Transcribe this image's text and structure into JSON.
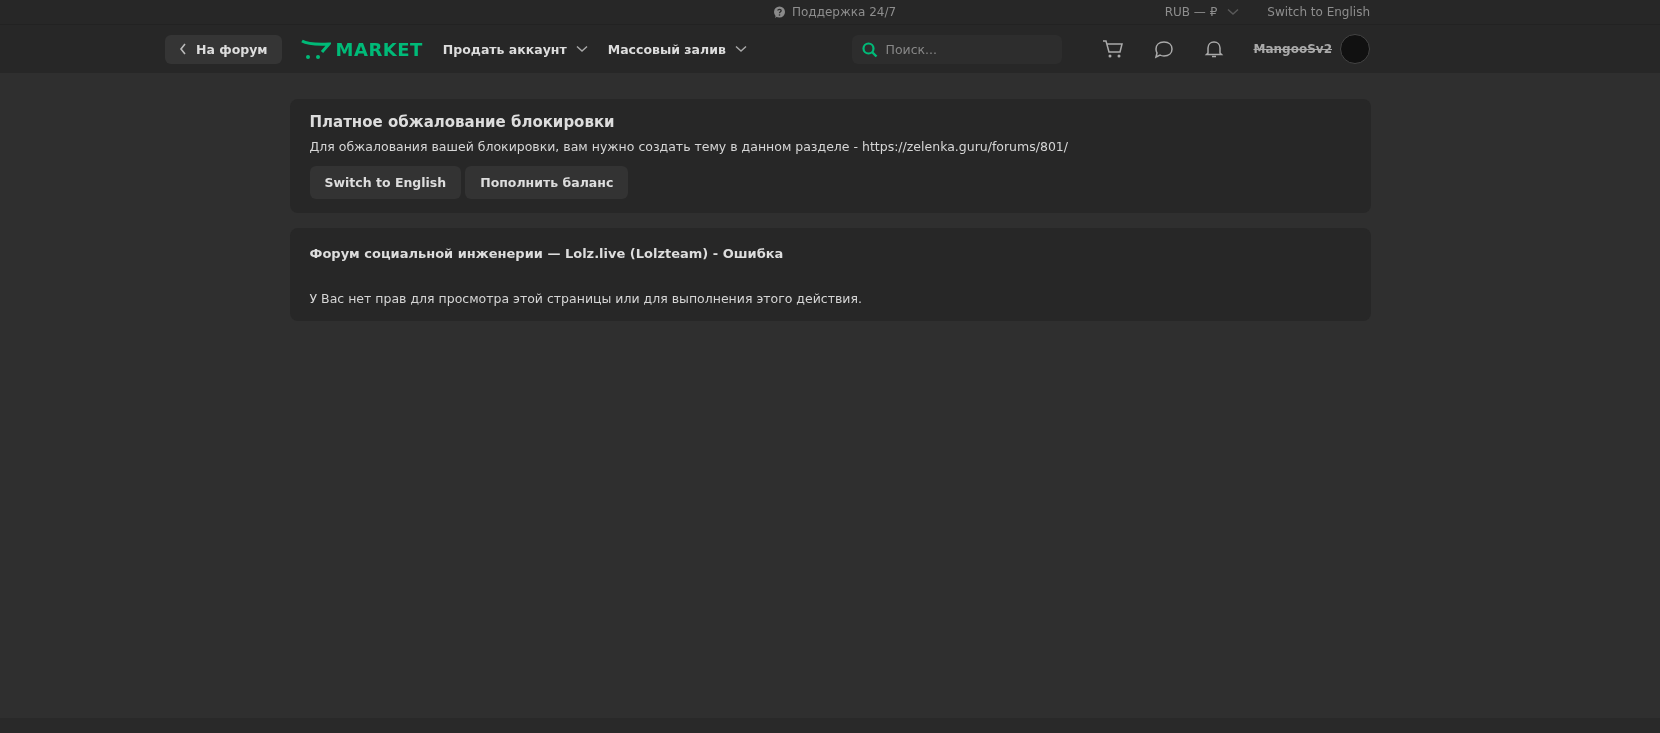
{
  "top_bar": {
    "support": "Поддержка 24/7",
    "currency": "RUB — ₽",
    "language_link": "Switch to English"
  },
  "nav": {
    "back_button": "На форум",
    "logo": "MARKET",
    "menus": [
      {
        "label": "Продать аккаунт"
      },
      {
        "label": "Массовый залив"
      }
    ],
    "search": {
      "placeholder": "Поиск..."
    },
    "username": "MangooSv2",
    "username_struck": true
  },
  "notice": {
    "title": "Платное обжалование блокировки",
    "text": "Для обжалования вашей блокировки, вам нужно создать тему в данном разделе - https://zelenka.guru/forums/801/",
    "buttons": [
      "Switch to English",
      "Пополнить баланс"
    ]
  },
  "error": {
    "title": "Форум социальной инженерии — Lolz.live (Lolzteam) - Ошибка",
    "message": "У Вас нет прав для просмотра этой страницы или для выполнения этого действия."
  }
}
